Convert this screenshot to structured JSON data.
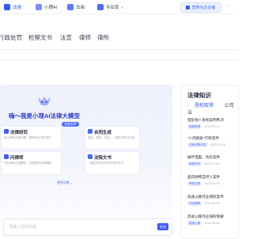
{
  "topbar": {
    "tabs": [
      {
        "label": "法搜",
        "active": true
      },
      {
        "label": "小理AI",
        "active": false
      },
      {
        "label": "法阅",
        "active": false
      },
      {
        "label": "专业库",
        "active": false
      }
    ],
    "upgrade_label": "您购为企业版"
  },
  "subnav": [
    "行政处罚",
    "检察文书",
    "法宣",
    "律师",
    "律所"
  ],
  "main": {
    "headline": "嗨～我是小理AI法律大模型",
    "badge": "深度思考",
    "cards": [
      {
        "title": "法律研究",
        "desc": "深入研究法律问题，提供专业分析意见"
      },
      {
        "title": "合同生成",
        "desc": "高效、精准、安全，一键生成专业合同"
      },
      {
        "title": "问律师",
        "desc": "专业律师在线解答，为您解决法律难题"
      },
      {
        "title": "法院文书",
        "desc": "一键生成专业诉状与裁判文书"
      }
    ],
    "more_link": "更多功能",
    "input_placeholder": "请输入您的问题",
    "send_label": "发送"
  },
  "knowledge": {
    "title": "法律知识",
    "tabs": [
      "授权取得",
      "公司法"
    ],
    "items": [
      {
        "title": "侵犯他人身权案例判决",
        "tag": "授权取得",
        "date": "2025-03-21"
      },
      {
        "title": "\"人肉搜索\"行政案件",
        "tag": "法律法规问答",
        "date": "2025-03-18"
      },
      {
        "title": "破坏电脑、伪劣案件",
        "tag": "案例分析",
        "date": "2024-11-04"
      },
      {
        "title": "盗窃财物自然人案件",
        "tag": "审判实践",
        "date": "2024-09-13"
      },
      {
        "title": "高速公路作业侵权案件",
        "tag": "司法解释",
        "date": "2024-08-05"
      },
      {
        "title": "高速公路作业侵权和解",
        "tag": "高速公路",
        "date": "2024-08-04"
      }
    ]
  },
  "colors": {
    "accent": "#2f5cff",
    "headline": "#2c3ec8"
  }
}
